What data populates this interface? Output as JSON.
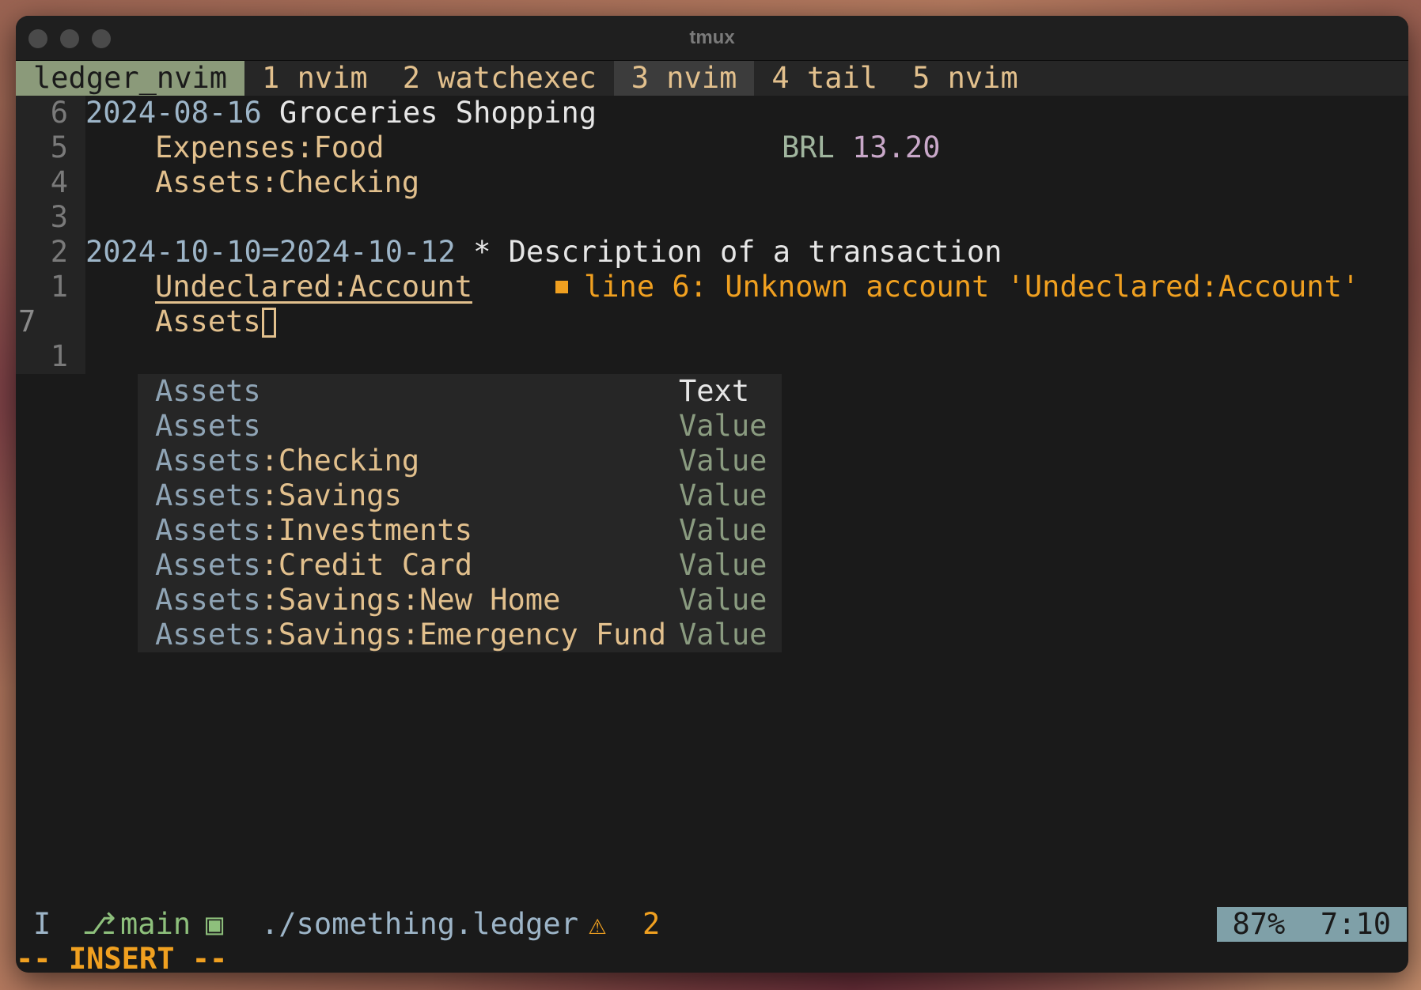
{
  "window": {
    "title": "tmux"
  },
  "tmux": {
    "session": "ledger_nvim",
    "windows": [
      {
        "label": "1 nvim",
        "active": false
      },
      {
        "label": "2 watchexec",
        "active": false
      },
      {
        "label": "3 nvim",
        "active": true
      },
      {
        "label": "4 tail",
        "active": false
      },
      {
        "label": "5 nvim",
        "active": false
      }
    ]
  },
  "editor": {
    "line_numbers": [
      "6",
      "5",
      "4",
      "3",
      "2",
      "1",
      "7",
      "1"
    ],
    "lines": {
      "l1_date": "2024-08-16",
      "l1_desc": "Groceries Shopping",
      "l2_account": "Expenses:Food",
      "l2_currency": "BRL",
      "l2_amount": "13.20",
      "l3_account": "Assets:Checking",
      "l5_date": "2024-10-10=2024-10-12",
      "l5_flag": "*",
      "l5_desc": "Description of a transaction",
      "l6_account": "Undeclared:Account",
      "l6_diagnostic": "line 6: Unknown account 'Undeclared:Account'",
      "l7_typed": "Assets"
    }
  },
  "completion": {
    "items": [
      {
        "match": "Assets",
        "rest": "",
        "kind": "Text"
      },
      {
        "match": "Assets",
        "rest": "",
        "kind": "Value"
      },
      {
        "match": "Assets",
        "rest": ":Checking",
        "kind": "Value"
      },
      {
        "match": "Assets",
        "rest": ":Savings",
        "kind": "Value"
      },
      {
        "match": "Assets",
        "rest": ":Investments",
        "kind": "Value"
      },
      {
        "match": "Assets",
        "rest": ":Credit Card",
        "kind": "Value"
      },
      {
        "match": "Assets",
        "rest": ":Savings:New Home",
        "kind": "Value"
      },
      {
        "match": "Assets",
        "rest": ":Savings:Emergency Fund",
        "kind": "Value"
      }
    ]
  },
  "statusline": {
    "mode_indicator": "I",
    "branch_icon": "git-branch-icon",
    "branch": "main",
    "file_icon": "ledger-file-icon",
    "file": "./something.ledger",
    "warning_icon": "warning-icon",
    "warnings": "2",
    "percent": "87%",
    "position": "7:10"
  },
  "cmdline": {
    "mode": "-- INSERT --"
  },
  "colors": {
    "accent": "#e2c08d",
    "warning": "#f0a020",
    "session_bg": "#8b9a7a",
    "position_bg": "#7fa0a8"
  }
}
